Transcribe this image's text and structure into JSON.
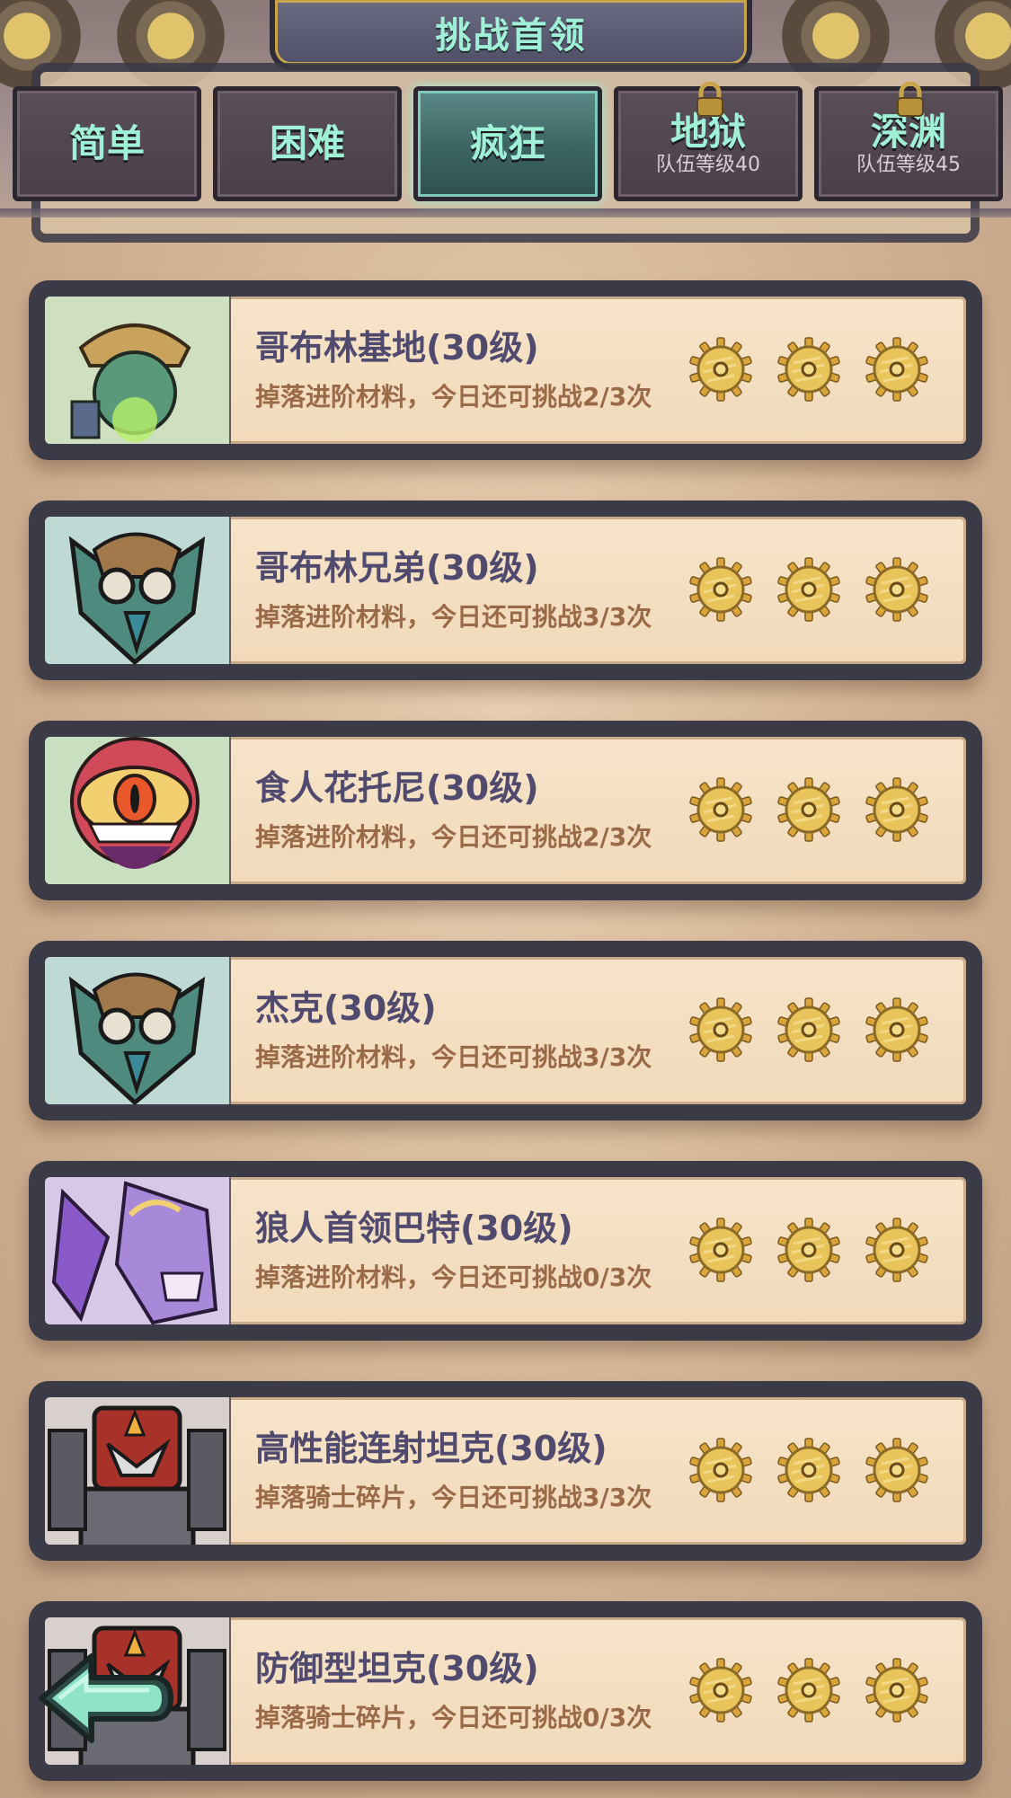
{
  "header": {
    "title": "挑战首领"
  },
  "tabs": [
    {
      "label": "简单",
      "sub": "",
      "locked": false,
      "active": false
    },
    {
      "label": "困难",
      "sub": "",
      "locked": false,
      "active": false
    },
    {
      "label": "疯狂",
      "sub": "",
      "locked": false,
      "active": true
    },
    {
      "label": "地狱",
      "sub": "队伍等级40",
      "locked": true,
      "active": false
    },
    {
      "label": "深渊",
      "sub": "队伍等级45",
      "locked": true,
      "active": false
    }
  ],
  "bosses": [
    {
      "name": "哥布林基地(30级)",
      "desc": "掉落进阶材料，今日还可挑战2/3次",
      "stars": 3,
      "portrait": "goblin-scout"
    },
    {
      "name": "哥布林兄弟(30级)",
      "desc": "掉落进阶材料，今日还可挑战3/3次",
      "stars": 3,
      "portrait": "goblin-goggles"
    },
    {
      "name": "食人花托尼(30级)",
      "desc": "掉落进阶材料，今日还可挑战2/3次",
      "stars": 3,
      "portrait": "man-eating-flower"
    },
    {
      "name": "杰克(30级)",
      "desc": "掉落进阶材料，今日还可挑战3/3次",
      "stars": 3,
      "portrait": "goblin-goggles"
    },
    {
      "name": "狼人首领巴特(30级)",
      "desc": "掉落进阶材料，今日还可挑战0/3次",
      "stars": 3,
      "portrait": "werewolf"
    },
    {
      "name": "高性能连射坦克(30级)",
      "desc": "掉落骑士碎片，今日还可挑战3/3次",
      "stars": 3,
      "portrait": "robot-tank"
    },
    {
      "name": "防御型坦克(30级)",
      "desc": "掉落骑士碎片，今日还可挑战0/3次",
      "stars": 3,
      "portrait": "robot-tank"
    }
  ],
  "colors": {
    "accent": "#9ff0d6",
    "name": "#4f4a6e",
    "desc": "#9a6a48",
    "frame": "#3b3a47"
  }
}
